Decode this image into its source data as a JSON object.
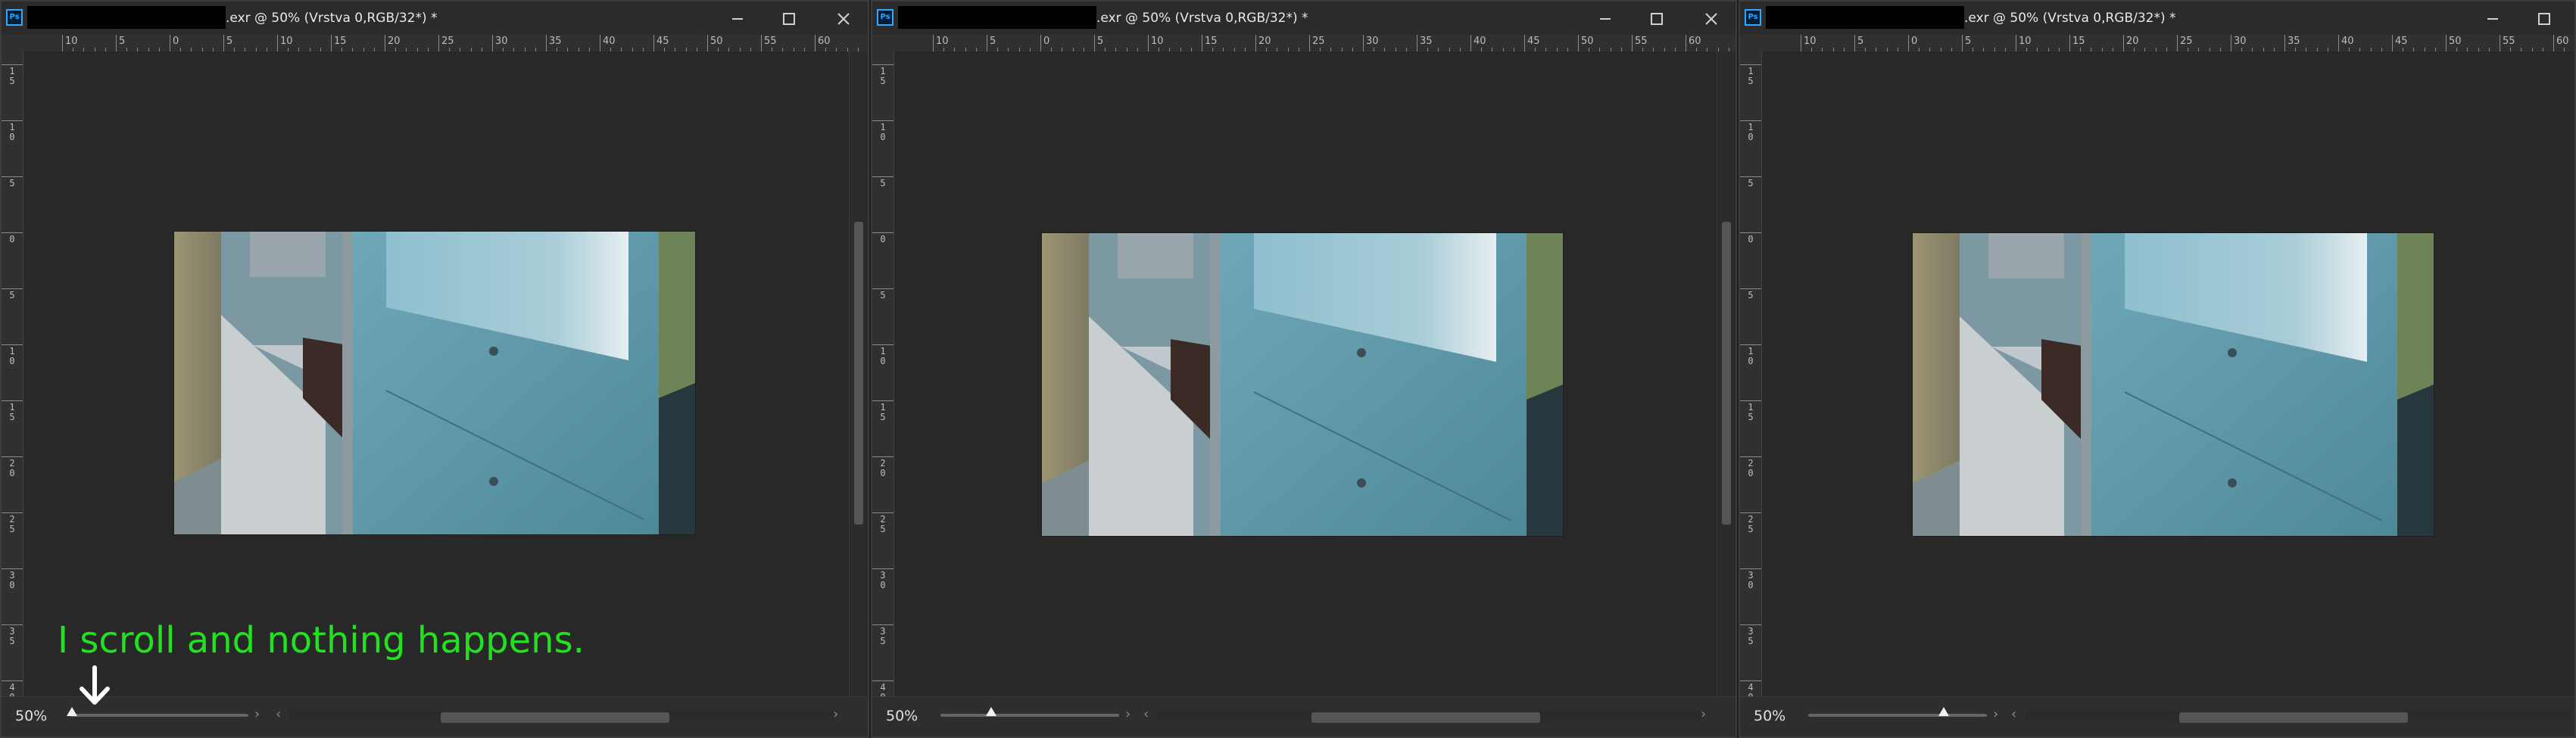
{
  "windows": [
    {
      "id": "w1",
      "app_icon_label": "Ps",
      "title": ".exr @ 50% (Vrstva 0,RGB/32*) *",
      "zoom": "50%",
      "h_ruler_labels": [
        "10",
        "5",
        "0",
        "5",
        "10",
        "15",
        "20",
        "25",
        "30",
        "35",
        "40",
        "45",
        "50",
        "55",
        "60"
      ],
      "v_ruler_labels": [
        "1\n5",
        "1\n0",
        "5",
        "0",
        "5",
        "1\n0",
        "1\n5",
        "2\n0",
        "2\n5",
        "3\n0",
        "3\n5",
        "4\n0"
      ]
    },
    {
      "id": "w2",
      "app_icon_label": "Ps",
      "title": ".exr @ 50% (Vrstva 0,RGB/32*) *",
      "zoom": "50%",
      "h_ruler_labels": [
        "10",
        "5",
        "0",
        "5",
        "10",
        "15",
        "20",
        "25",
        "30",
        "35",
        "40",
        "45",
        "50",
        "55",
        "60"
      ],
      "v_ruler_labels": [
        "1\n5",
        "1\n0",
        "5",
        "0",
        "5",
        "1\n0",
        "1\n5",
        "2\n0",
        "2\n5",
        "3\n0",
        "3\n5",
        "4\n0"
      ]
    },
    {
      "id": "w3",
      "app_icon_label": "Ps",
      "title": ".exr @ 50% (Vrstva 0,RGB/32*) *",
      "zoom": "50%",
      "h_ruler_labels": [
        "10",
        "5",
        "0",
        "5",
        "10",
        "15",
        "20",
        "25",
        "30",
        "35",
        "40",
        "45",
        "50",
        "55",
        "60"
      ],
      "v_ruler_labels": [
        "1\n5",
        "1\n0",
        "5",
        "0",
        "5",
        "1\n0",
        "1\n5",
        "2\n0",
        "2\n5",
        "3\n0",
        "3\n5",
        "4\n0"
      ]
    }
  ],
  "window_controls": {
    "minimize": "—",
    "maximize": "☐",
    "close": "✕"
  },
  "scroll_arrows": {
    "left": "‹",
    "right": "›"
  },
  "annotation": {
    "text": "I scroll and nothing happens.",
    "color": "#22e11e"
  },
  "colors": {
    "panel": "#282828",
    "ruler": "#303030",
    "cabinet": "#5e9aa8",
    "wood": "#9a9270"
  }
}
